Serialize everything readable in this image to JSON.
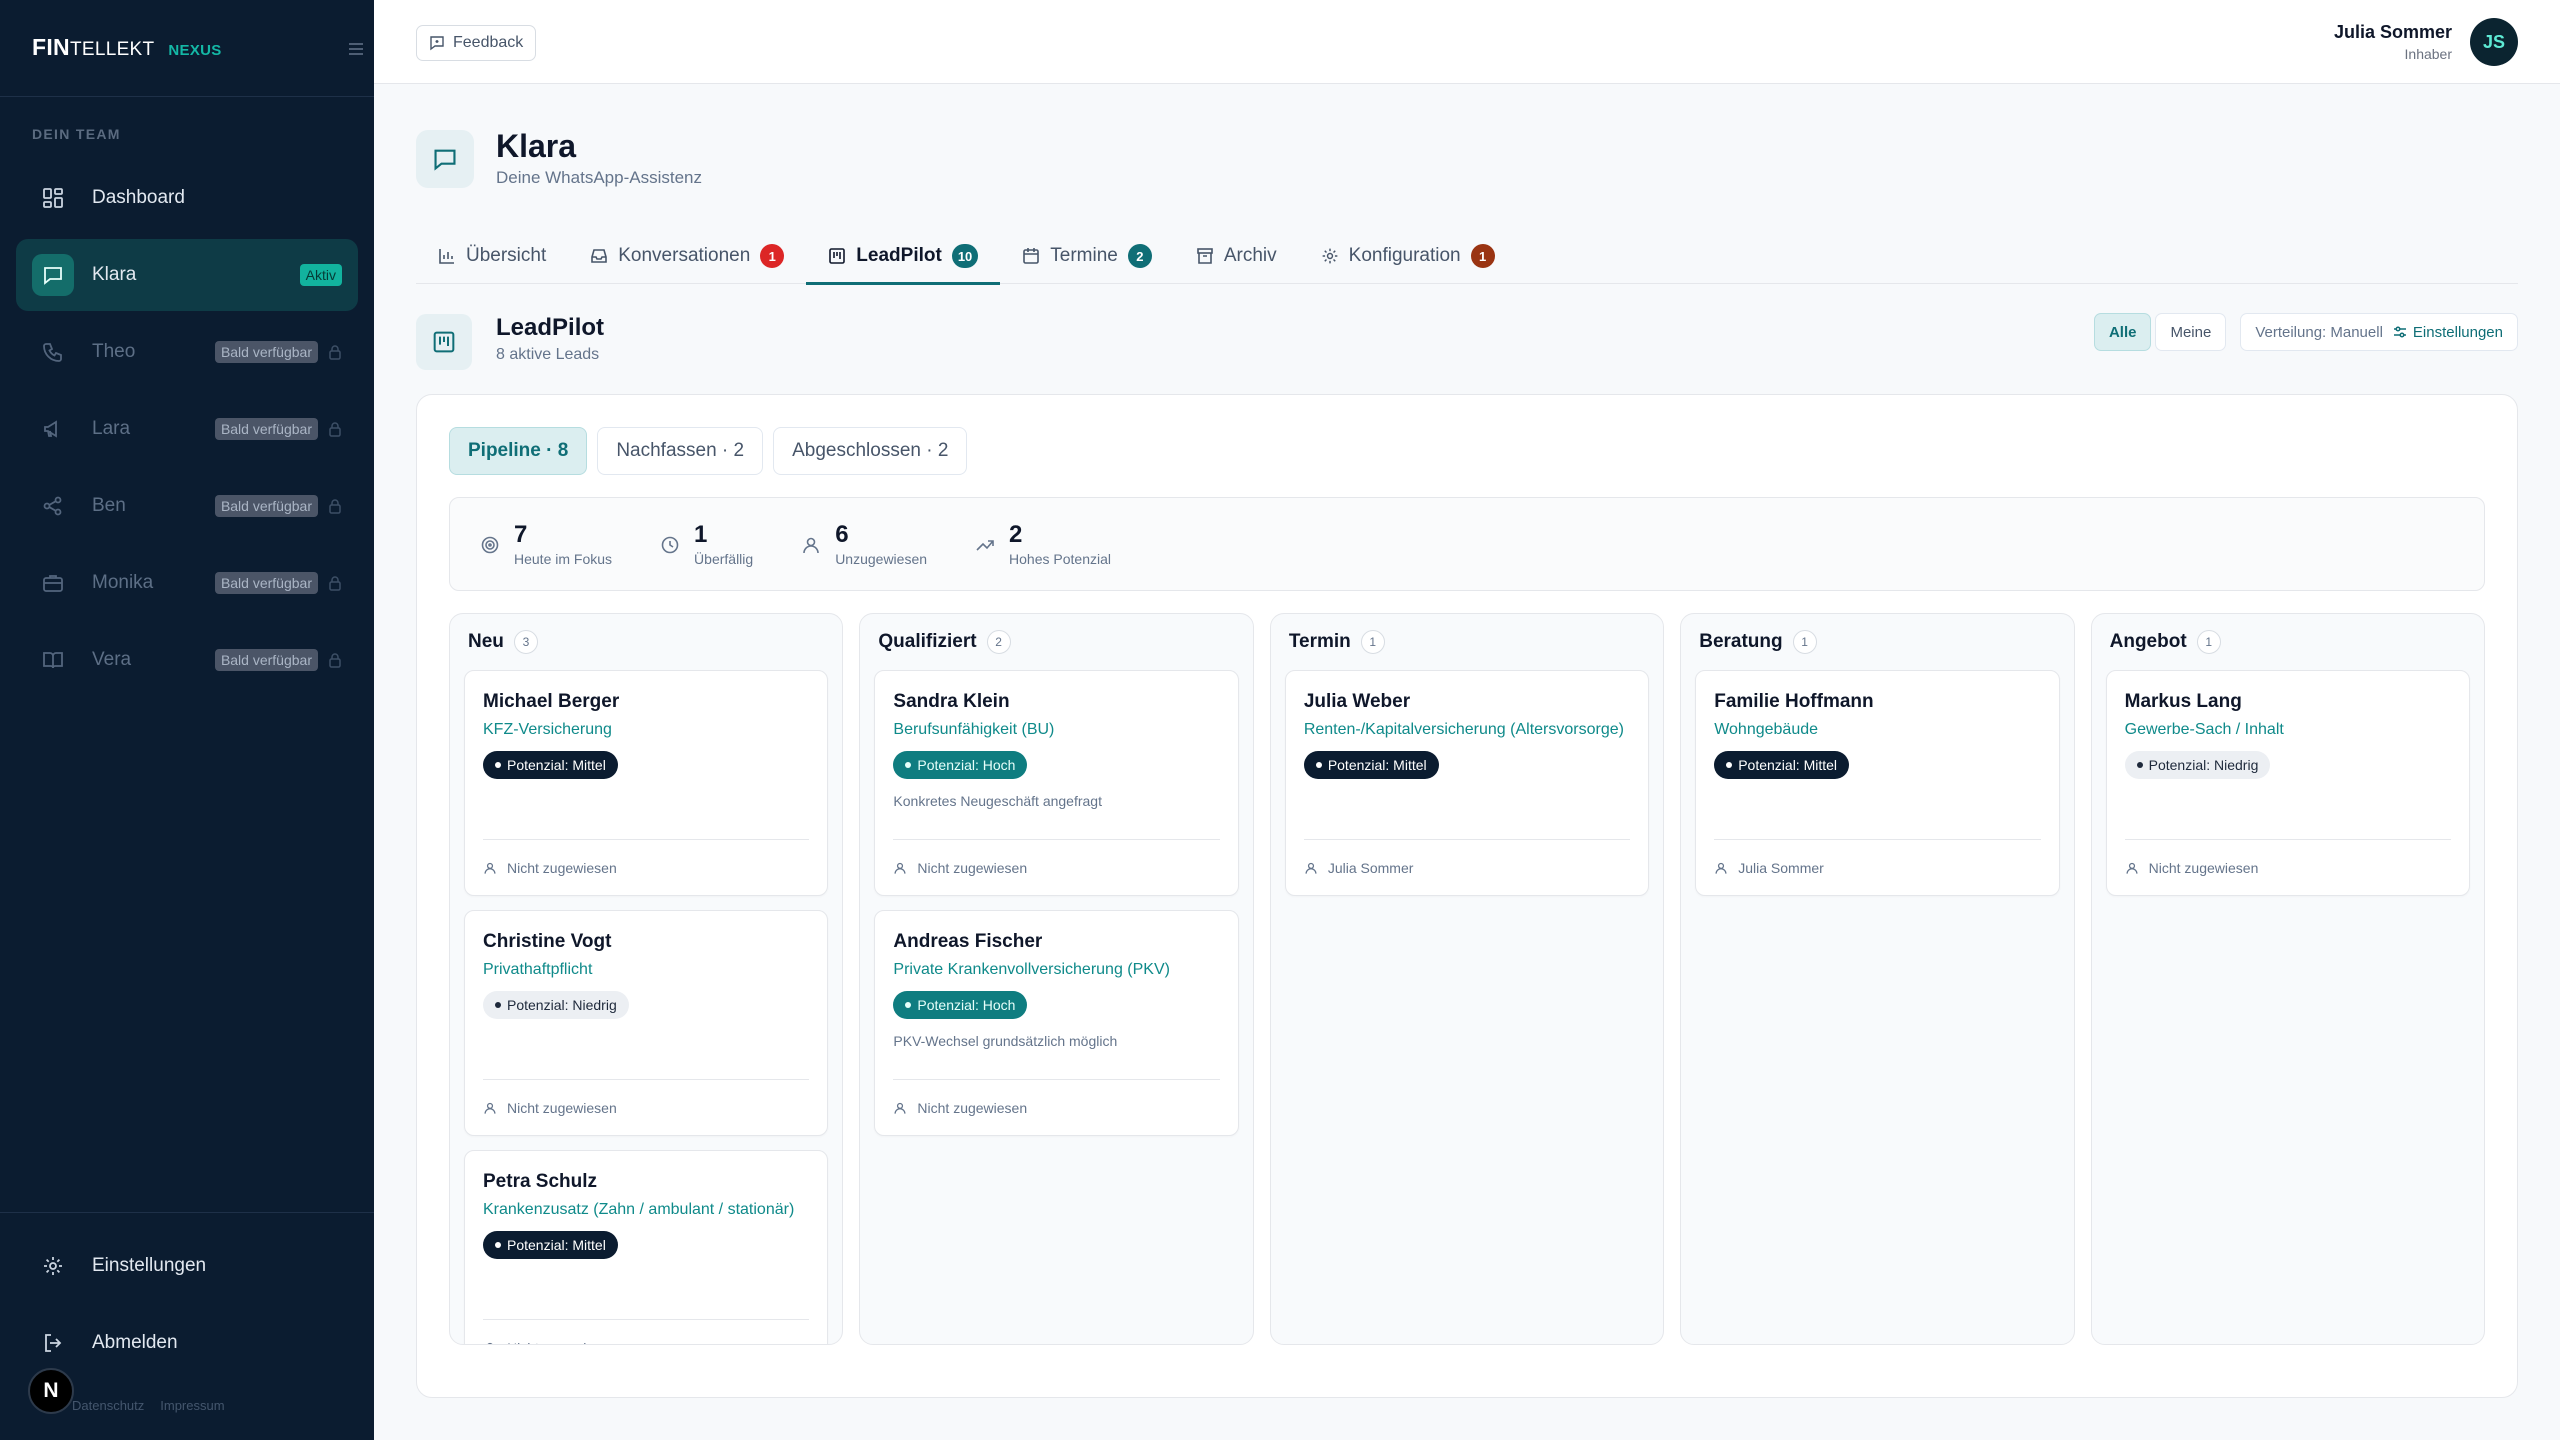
{
  "brand": {
    "part1": "FIN",
    "part2": "TELLEKT",
    "part3": "NEXUS"
  },
  "sidebar": {
    "section": "DEIN TEAM",
    "items": [
      {
        "label": "Dashboard",
        "badge": "",
        "icon": "grid-icon"
      },
      {
        "label": "Klara",
        "badge": "Aktiv",
        "icon": "chat-icon"
      },
      {
        "label": "Theo",
        "badge": "Bald verfügbar",
        "icon": "phone-icon"
      },
      {
        "label": "Lara",
        "badge": "Bald verfügbar",
        "icon": "megaphone-icon"
      },
      {
        "label": "Ben",
        "badge": "Bald verfügbar",
        "icon": "share-icon"
      },
      {
        "label": "Monika",
        "badge": "Bald verfügbar",
        "icon": "briefcase-icon"
      },
      {
        "label": "Vera",
        "badge": "Bald verfügbar",
        "icon": "book-icon"
      }
    ],
    "settings": "Einstellungen",
    "logout": "Abmelden",
    "legal1": "Datenschutz",
    "legal2": "Impressum",
    "avatar": "N"
  },
  "topbar": {
    "feedback": "Feedback",
    "user_name": "Julia Sommer",
    "user_role": "Inhaber",
    "user_initials": "JS"
  },
  "header": {
    "title": "Klara",
    "subtitle": "Deine WhatsApp-Assistenz"
  },
  "tabs": [
    {
      "label": "Übersicht",
      "count": ""
    },
    {
      "label": "Konversationen",
      "count": "1"
    },
    {
      "label": "LeadPilot",
      "count": "10"
    },
    {
      "label": "Termine",
      "count": "2"
    },
    {
      "label": "Archiv",
      "count": ""
    },
    {
      "label": "Konfiguration",
      "count": "1"
    }
  ],
  "leadpilot": {
    "title": "LeadPilot",
    "subtitle": "8 aktive Leads",
    "filter_all": "Alle",
    "filter_mine": "Meine",
    "distribution": "Verteilung: Manuell",
    "settings": "Einstellungen"
  },
  "subtabs": [
    "Pipeline · 8",
    "Nachfassen · 2",
    "Abgeschlossen · 2"
  ],
  "stats": [
    {
      "value": "7",
      "label": "Heute im Fokus"
    },
    {
      "value": "1",
      "label": "Überfällig"
    },
    {
      "value": "6",
      "label": "Unzugewiesen"
    },
    {
      "value": "2",
      "label": "Hohes Potenzial"
    }
  ],
  "columns": [
    {
      "title": "Neu",
      "count": "3",
      "cards": [
        {
          "name": "Michael Berger",
          "product": "KFZ-Versicherung",
          "potential": "Potenzial: Mittel",
          "note": "",
          "assignee": "Nicht zugewiesen"
        },
        {
          "name": "Christine Vogt",
          "product": "Privathaftpflicht",
          "potential": "Potenzial: Niedrig",
          "note": "",
          "assignee": "Nicht zugewiesen"
        },
        {
          "name": "Petra Schulz",
          "product": "Krankenzusatz (Zahn / ambulant / stationär)",
          "potential": "Potenzial: Mittel",
          "note": "",
          "assignee": "Nicht zugewiesen"
        }
      ]
    },
    {
      "title": "Qualifiziert",
      "count": "2",
      "cards": [
        {
          "name": "Sandra Klein",
          "product": "Berufsunfähigkeit (BU)",
          "potential": "Potenzial: Hoch",
          "note": "Konkretes Neugeschäft angefragt",
          "assignee": "Nicht zugewiesen"
        },
        {
          "name": "Andreas Fischer",
          "product": "Private Krankenvollversicherung (PKV)",
          "potential": "Potenzial: Hoch",
          "note": "PKV-Wechsel grundsätzlich möglich",
          "assignee": "Nicht zugewiesen"
        }
      ]
    },
    {
      "title": "Termin",
      "count": "1",
      "cards": [
        {
          "name": "Julia Weber",
          "product": "Renten-/Kapitalversicherung (Altersvorsorge)",
          "potential": "Potenzial: Mittel",
          "note": "",
          "assignee": "Julia Sommer"
        }
      ]
    },
    {
      "title": "Beratung",
      "count": "1",
      "cards": [
        {
          "name": "Familie Hoffmann",
          "product": "Wohngebäude",
          "potential": "Potenzial: Mittel",
          "note": "",
          "assignee": "Julia Sommer"
        }
      ]
    },
    {
      "title": "Angebot",
      "count": "1",
      "cards": [
        {
          "name": "Markus Lang",
          "product": "Gewerbe-Sach / Inhalt",
          "potential": "Potenzial: Niedrig",
          "note": "",
          "assignee": "Nicht zugewiesen"
        }
      ]
    }
  ]
}
